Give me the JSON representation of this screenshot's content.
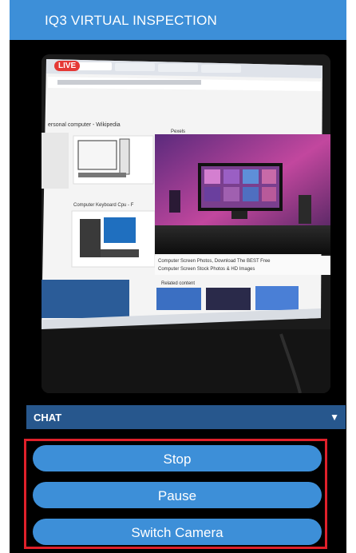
{
  "header": {
    "title": "IQ3 VIRTUAL INSPECTION"
  },
  "feed": {
    "live_label": "LIVE",
    "snippets": {
      "search_result": "ersonal computer - Wikipedia",
      "pexels": "Pexels",
      "caption_1": "Computer Screen Photos, Download The BEST Free",
      "caption_2": "Computer Screen Stock Photos & HD Images",
      "keyboard": "Computer Keyboard Cpu - F",
      "related": "Related content"
    }
  },
  "chat": {
    "label": "CHAT",
    "toggle_icon": "▼"
  },
  "controls": {
    "stop": "Stop",
    "pause": "Pause",
    "switch_camera": "Switch Camera"
  },
  "colors": {
    "header_bg": "#3d8fd8",
    "chat_bg": "#27578d",
    "button_bg": "#3d8fd8",
    "highlight_border": "#e0202a"
  }
}
